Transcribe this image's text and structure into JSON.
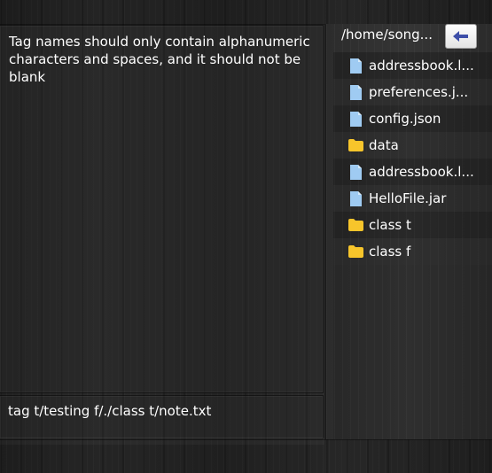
{
  "result_display": {
    "text": "Tag names should only contain alphanumeric characters and spaces, and it should not be blank"
  },
  "command_box": {
    "value": "tag t/testing f/./class t/note.txt"
  },
  "file_browser": {
    "path": "/home/song...",
    "back_button_icon": "arrow-left-icon",
    "items": [
      {
        "label": "addressbook.l...",
        "type": "file"
      },
      {
        "label": "preferences.j...",
        "type": "file"
      },
      {
        "label": "config.json",
        "type": "file"
      },
      {
        "label": "data",
        "type": "folder"
      },
      {
        "label": "addressbook.l...",
        "type": "file"
      },
      {
        "label": "HelloFile.jar",
        "type": "file"
      },
      {
        "label": "class t",
        "type": "folder"
      },
      {
        "label": "class f",
        "type": "folder"
      }
    ]
  },
  "colors": {
    "file_icon": "#9fcbf2",
    "folder_icon": "#f7c52b",
    "back_arrow": "#3d4ea8"
  }
}
